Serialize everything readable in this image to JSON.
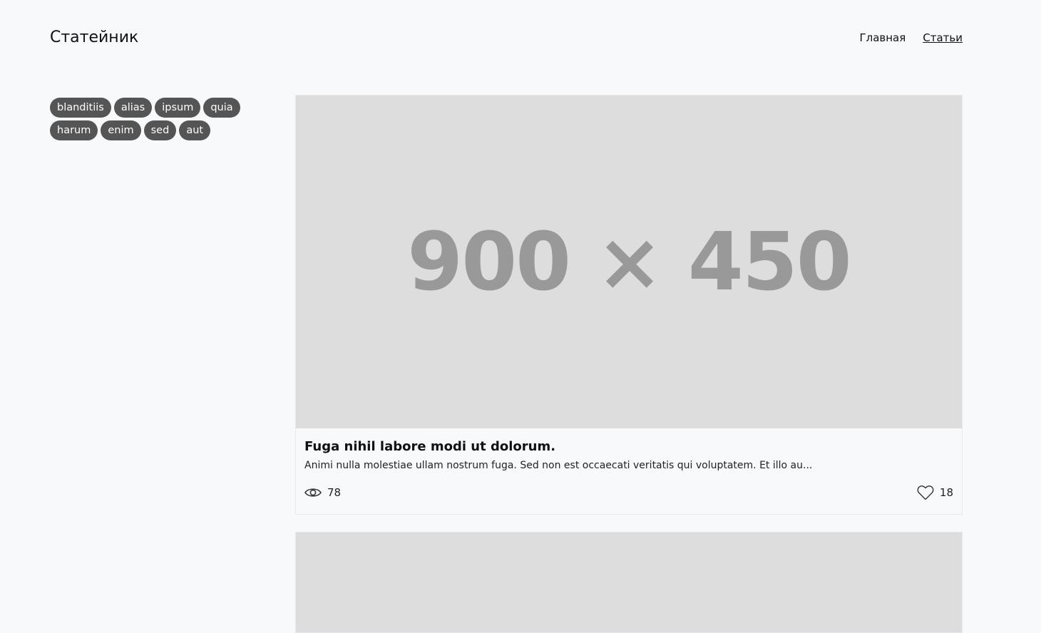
{
  "header": {
    "brand": "Статейник",
    "nav": [
      {
        "label": "Главная"
      },
      {
        "label": "Статьи"
      }
    ]
  },
  "sidebar": {
    "tags": [
      "blanditiis",
      "alias",
      "ipsum",
      "quia",
      "harum",
      "enim",
      "sed",
      "aut"
    ]
  },
  "articles": [
    {
      "image_placeholder": "900 × 450",
      "title": "Fuga nihil labore modi ut dolorum.",
      "excerpt": "Animi nulla molestiae ullam nostrum fuga. Sed non est occaecati veritatis qui voluptatem. Et illo au...",
      "views": "78",
      "likes": "18",
      "icons": {
        "views": "eye-icon",
        "likes": "heart-icon"
      }
    }
  ],
  "colors": {
    "background": "#f8f9fb",
    "tag_bg": "#555555",
    "placeholder_bg": "#dddddd",
    "placeholder_text": "#999999"
  }
}
